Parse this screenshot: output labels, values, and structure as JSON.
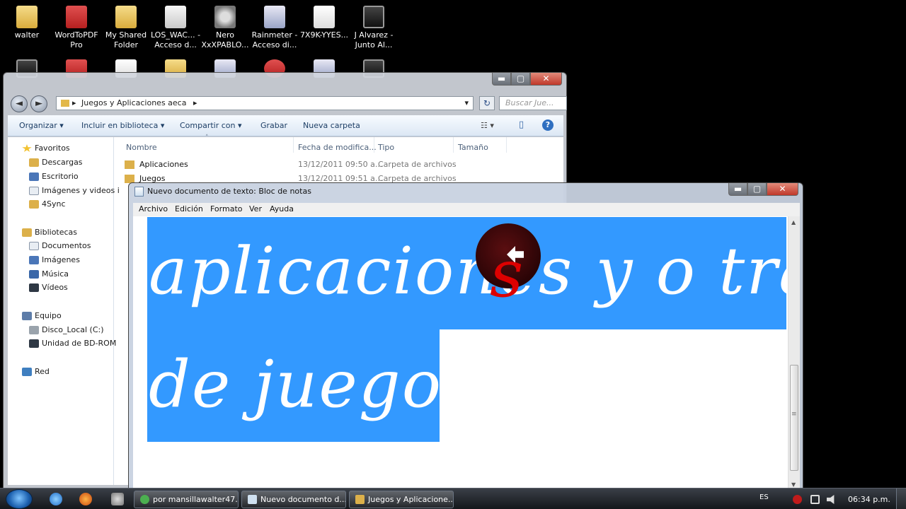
{
  "desktop": {
    "icons": [
      {
        "label": "walter"
      },
      {
        "label": "WordToPDF Pro"
      },
      {
        "label": "My Shared Folder"
      },
      {
        "label": "LOS_WAC... - Acceso d..."
      },
      {
        "label": "Nero XxXPABLO..."
      },
      {
        "label": "Rainmeter - Acceso di..."
      },
      {
        "label": "7X9K-YYES..."
      },
      {
        "label": "J Alvarez - Junto Al..."
      }
    ]
  },
  "explorer": {
    "caption_buttons": {
      "minimize": "▬",
      "maximize": "▢",
      "close": "✕"
    },
    "nav": {
      "back": "◄",
      "forward": "►"
    },
    "address": {
      "path": "Juegos y Aplicaciones aeca",
      "sep": "▸",
      "dropdown": "▾"
    },
    "refresh_glyph": "↻",
    "search_placeholder": "Buscar Jue...",
    "toolbar": {
      "organize": "Organizar ▾",
      "include": "Incluir en biblioteca ▾",
      "share": "Compartir con ▾",
      "burn": "Grabar",
      "new_folder": "Nueva carpeta",
      "views": "☷ ▾",
      "pane": "▯",
      "help": "?"
    },
    "navpane": {
      "favorites": "Favoritos",
      "downloads": "Descargas",
      "desktop": "Escritorio",
      "images_videos": "Imágenes y videos i",
      "foursync": "4Sync",
      "libraries": "Bibliotecas",
      "documents": "Documentos",
      "images": "Imágenes",
      "music": "Música",
      "videos": "Vídeos",
      "computer": "Equipo",
      "local_disk": "Disco_Local (C:)",
      "bd_rom": "Unidad de BD-ROM",
      "network": "Red"
    },
    "columns": {
      "name": "Nombre",
      "modified": "Fecha de modifica...",
      "type": "Tipo",
      "size": "Tamaño",
      "sort_glyph": "˄"
    },
    "files": [
      {
        "name": "Aplicaciones",
        "modified": "13/12/2011 09:50 a...",
        "type": "Carpeta de archivos"
      },
      {
        "name": "Juegos",
        "modified": "13/12/2011 09:51 a...",
        "type": "Carpeta de archivos"
      }
    ]
  },
  "notepad": {
    "title": "Nuevo documento de texto: Bloc de notas",
    "caption_buttons": {
      "minimize": "▬",
      "maximize": "▢",
      "close": "✕"
    },
    "menu": {
      "file": "Archivo",
      "edit": "Edición",
      "format": "Formato",
      "view": "Ver",
      "help": "Ayuda"
    },
    "content_line1": "aplicaciones y o tra",
    "content_line2": "de juegos",
    "cursor_letter": "s",
    "scroll": {
      "up": "▲",
      "down": "▼",
      "grip": "≡"
    }
  },
  "taskbar": {
    "tasks": [
      {
        "label": "por mansillawalter47...",
        "color": "#4caf50"
      },
      {
        "label": "Nuevo documento d...",
        "color": "#cfe0f0"
      },
      {
        "label": "Juegos y Aplicacione...",
        "color": "#dcb04a"
      }
    ],
    "language": "ES",
    "clock": "06:34 p.m."
  }
}
